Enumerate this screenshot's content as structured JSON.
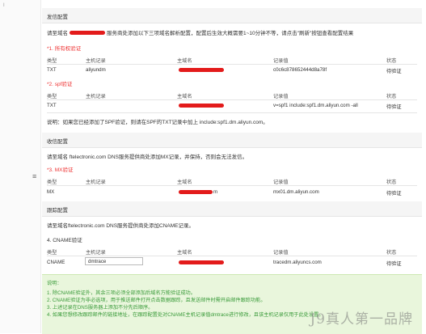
{
  "sidebar": {
    "mark": "I",
    "menu_icon": "≡"
  },
  "send": {
    "title": "发信配置",
    "desc_a": "请至域名",
    "desc_b": "服务商处添加以下三项域名解析配置，配置后生效大概需要1~10分钟不等，请点击\"刷新\"按钮查看配置结果",
    "s1": "*1. 所有权验证",
    "s2": "*2. spf验证",
    "spf_note": "说明：如果您已经添加了SPF验证，则请在SPF的TXT记录中加上 include:spf1.dm.aliyun.com。"
  },
  "headers": {
    "type": "类型",
    "host": "主机记录",
    "domain": "主域名",
    "value": "记录值",
    "status": "状态"
  },
  "rows": {
    "r1": {
      "type": "TXT",
      "host": "aliyundm",
      "value": "c0c6c878652444d8a78f",
      "status": "待验证"
    },
    "r2": {
      "type": "TXT",
      "value": "v=spf1 include:spf1.dm.aliyun.com -all",
      "status": "待验证"
    },
    "r3": {
      "type": "MX",
      "domain_suffix": "m",
      "value": "mx01.dm.aliyun.com",
      "status": "待验证"
    },
    "r4": {
      "type": "CNAME",
      "host": "dmtrace",
      "value": "tracedm.aliyuncs.com",
      "status": "待验证"
    }
  },
  "receive": {
    "title": "收信配置",
    "desc": "请至域名 ftelectronic.com DNS服务提供商处添加MX记录，并保持，否则会无法发信。",
    "s3": "*3. MX验证"
  },
  "track": {
    "title": "跟踪配置",
    "desc": "请至域名ftelectronic.com DNS服务提供商处添加CNAME记录。",
    "s4": "4. CNAME验证"
  },
  "notes": {
    "title": "说明：",
    "n1": "1. 除CNAME验证外，其余三项必须全部添加后域名方能验证成功。",
    "n2": "2. CNAME验证为非必选项，用于推送邮件打开点击数据跟踪，且发送邮件时需开启邮件跟踪功能。",
    "n3": "3. 上述记录在DNS服务器上添加不分先后顺序。",
    "n4": "4. 如果您想修改跟踪邮件的链接地址，在跟踪配置处对CNAME主机记录值dmtrace进行修改，且该主机记录仅用于此处设置。"
  },
  "watermark": "J9真人第一品牌"
}
